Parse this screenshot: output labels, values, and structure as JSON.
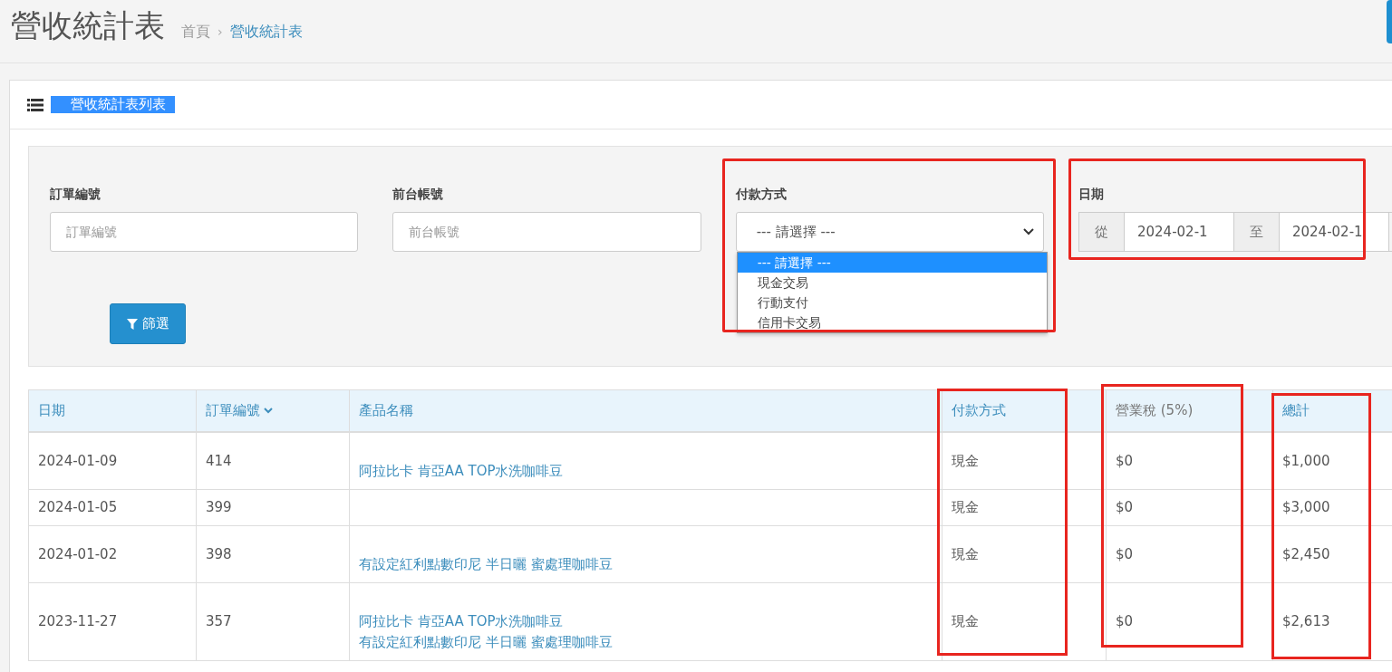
{
  "header": {
    "title": "營收統計表",
    "breadcrumb": [
      {
        "label": "首頁",
        "current": false
      },
      {
        "label": "營收統計表",
        "current": true
      }
    ],
    "separator": "›"
  },
  "card": {
    "title": "營收統計表列表",
    "title_selected": true
  },
  "filters": [
    {
      "kind": "text",
      "label": "訂單編號",
      "placeholder": "訂單編號",
      "annotated": false
    },
    {
      "kind": "text",
      "label": "前台帳號",
      "placeholder": "前台帳號",
      "annotated": false
    },
    {
      "kind": "select",
      "label": "付款方式",
      "value": "--- 請選擇 ---",
      "expanded": true,
      "annotated": true,
      "options": [
        {
          "label": "--- 請選擇 ---",
          "selected": true
        },
        {
          "label": "現金交易",
          "selected": false
        },
        {
          "label": "行動支付",
          "selected": false
        },
        {
          "label": "信用卡交易",
          "selected": false
        }
      ]
    },
    {
      "kind": "daterange",
      "label": "日期",
      "from_label": "從",
      "from": "2024-02-1",
      "to_label": "至",
      "to": "2024-02-1",
      "annotated": true
    }
  ],
  "filter_button": "篩選",
  "table": {
    "columns": [
      {
        "label": "日期",
        "link": true,
        "sorted": false,
        "annotated": false
      },
      {
        "label": "訂單編號",
        "link": true,
        "sorted": true,
        "annotated": false
      },
      {
        "label": "產品名稱",
        "link": true,
        "sorted": false,
        "annotated": false
      },
      {
        "label": "付款方式",
        "link": true,
        "sorted": false,
        "annotated": true
      },
      {
        "label": "營業稅 (5%)",
        "link": false,
        "sorted": false,
        "annotated": true
      },
      {
        "label": "總計",
        "link": true,
        "sorted": false,
        "annotated": true
      }
    ],
    "rows": [
      {
        "date": "2024-01-09",
        "order": "414",
        "products": [
          "阿拉比卡 肯亞AA TOP水洗咖啡豆"
        ],
        "payment": "現金",
        "tax": "$0",
        "total": "$1,000"
      },
      {
        "date": "2024-01-05",
        "order": "399",
        "products": [],
        "payment": "現金",
        "tax": "$0",
        "total": "$3,000"
      },
      {
        "date": "2024-01-02",
        "order": "398",
        "products": [
          "有設定紅利點數印尼 半日曬 蜜處理咖啡豆"
        ],
        "payment": "現金",
        "tax": "$0",
        "total": "$2,450"
      },
      {
        "date": "2023-11-27",
        "order": "357",
        "products": [
          "阿拉比卡 肯亞AA TOP水洗咖啡豆",
          "有設定紅利點數印尼 半日曬 蜜處理咖啡豆"
        ],
        "payment": "現金",
        "tax": "$0",
        "total": "$2,613"
      }
    ]
  }
}
